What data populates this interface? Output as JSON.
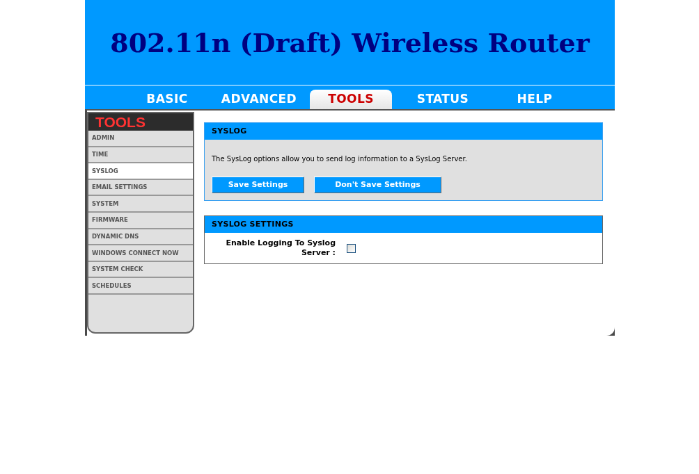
{
  "header": {
    "title": "802.11n (Draft) Wireless Router"
  },
  "tabs": [
    {
      "label": "BASIC",
      "selected": false
    },
    {
      "label": "ADVANCED",
      "selected": false
    },
    {
      "label": "TOOLS",
      "selected": true
    },
    {
      "label": "STATUS",
      "selected": false
    },
    {
      "label": "HELP",
      "selected": false
    }
  ],
  "sidebar": {
    "title": "TOOLS",
    "items": [
      {
        "label": "ADMIN",
        "selected": false
      },
      {
        "label": "TIME",
        "selected": false
      },
      {
        "label": "SYSLOG",
        "selected": true
      },
      {
        "label": "EMAIL SETTINGS",
        "selected": false
      },
      {
        "label": "SYSTEM",
        "selected": false
      },
      {
        "label": "FIRMWARE",
        "selected": false
      },
      {
        "label": "DYNAMIC DNS",
        "selected": false
      },
      {
        "label": "WINDOWS CONNECT NOW",
        "selected": false
      },
      {
        "label": "SYSTEM CHECK",
        "selected": false
      },
      {
        "label": "SCHEDULES",
        "selected": false
      }
    ]
  },
  "syslog": {
    "title": "SYSLOG",
    "description": "The SysLog options allow you to send log information to a SysLog Server.",
    "buttons": [
      "Save Settings",
      "Don't Save Settings"
    ]
  },
  "syslog_settings": {
    "title": "SYSLOG SETTINGS",
    "fields": [
      {
        "label": "Enable Logging To Syslog Server :",
        "checked": false
      }
    ]
  }
}
